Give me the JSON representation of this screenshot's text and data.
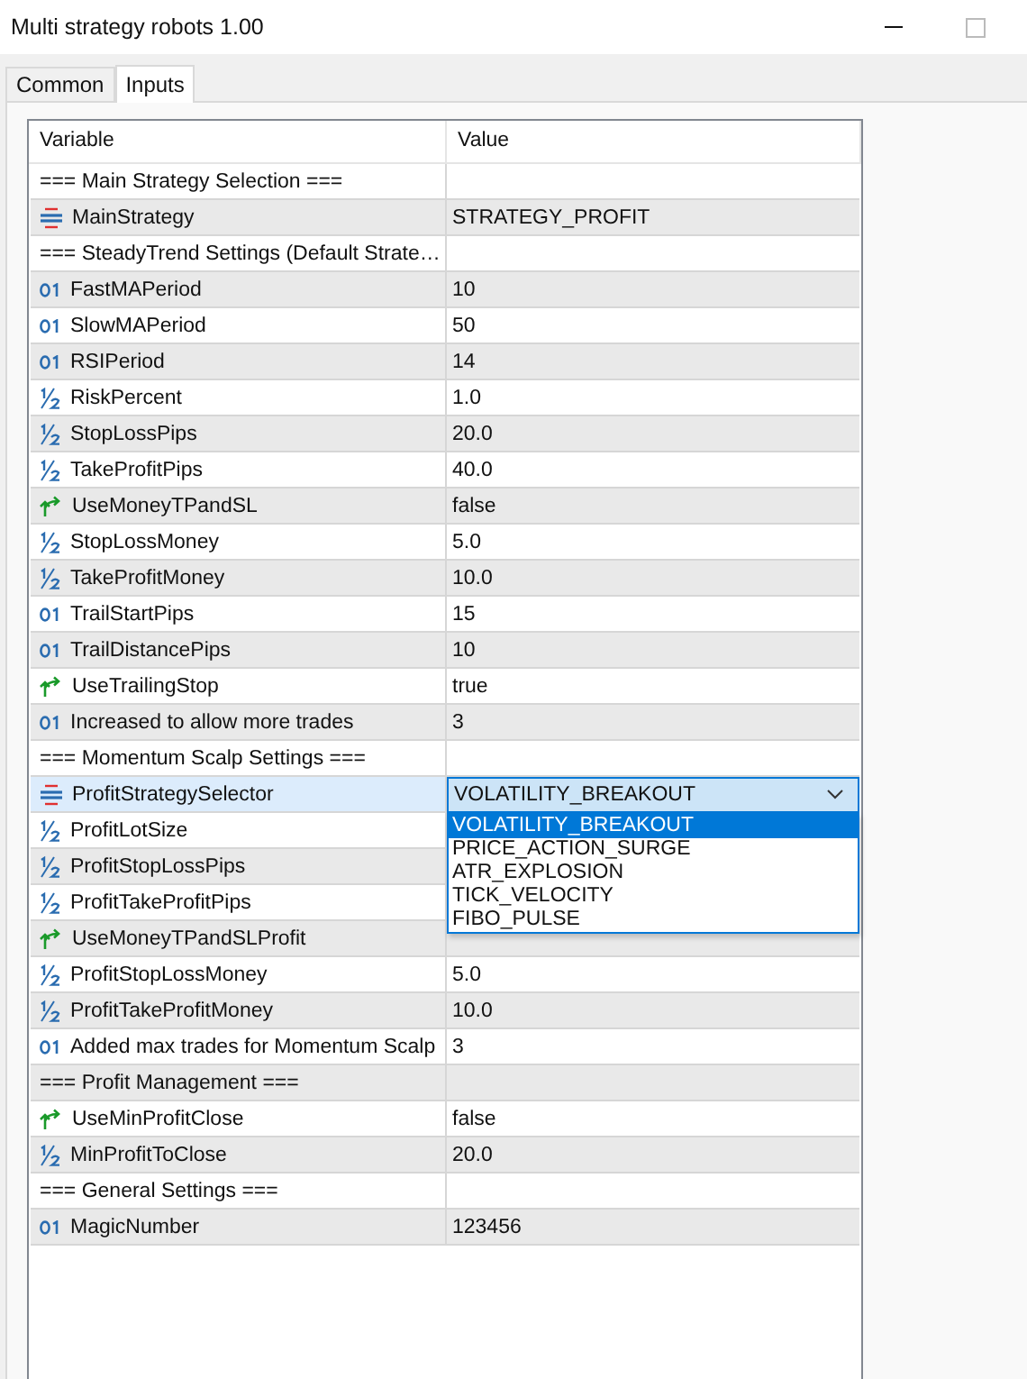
{
  "window": {
    "title": "Multi strategy robots 1.00"
  },
  "tabs": [
    {
      "label": "Common",
      "selected": false
    },
    {
      "label": "Inputs",
      "selected": true
    }
  ],
  "table": {
    "columns": [
      "Variable",
      "Value"
    ],
    "rows": [
      {
        "kind": "section",
        "name": "=== Main Strategy Selection ===",
        "selected": false
      },
      {
        "kind": "enum",
        "name": "MainStrategy",
        "value": "STRATEGY_PROFIT",
        "selected": false
      },
      {
        "kind": "section",
        "name": "=== SteadyTrend Settings (Default Strate…",
        "selected": false
      },
      {
        "kind": "int",
        "name": "FastMAPeriod",
        "value": "10",
        "selected": false
      },
      {
        "kind": "int",
        "name": "SlowMAPeriod",
        "value": "50",
        "selected": false
      },
      {
        "kind": "int",
        "name": "RSIPeriod",
        "value": "14",
        "selected": false
      },
      {
        "kind": "double",
        "name": "RiskPercent",
        "value": "1.0",
        "selected": false
      },
      {
        "kind": "double",
        "name": "StopLossPips",
        "value": "20.0",
        "selected": false
      },
      {
        "kind": "double",
        "name": "TakeProfitPips",
        "value": "40.0",
        "selected": false
      },
      {
        "kind": "bool",
        "name": "UseMoneyTPandSL",
        "value": "false",
        "selected": false
      },
      {
        "kind": "double",
        "name": "StopLossMoney",
        "value": "5.0",
        "selected": false
      },
      {
        "kind": "double",
        "name": "TakeProfitMoney",
        "value": "10.0",
        "selected": false
      },
      {
        "kind": "int",
        "name": "TrailStartPips",
        "value": "15",
        "selected": false
      },
      {
        "kind": "int",
        "name": "TrailDistancePips",
        "value": "10",
        "selected": false
      },
      {
        "kind": "bool",
        "name": "UseTrailingStop",
        "value": "true",
        "selected": false
      },
      {
        "kind": "int",
        "name": "Increased to allow more trades",
        "value": "3",
        "selected": false
      },
      {
        "kind": "section",
        "name": "=== Momentum Scalp Settings ===",
        "selected": false
      },
      {
        "kind": "enum",
        "name": "ProfitStrategySelector",
        "selected": true,
        "dropdown": {
          "value": "VOLATILITY_BREAKOUT",
          "options": [
            {
              "label": "VOLATILITY_BREAKOUT",
              "selected": true
            },
            {
              "label": "PRICE_ACTION_SURGE",
              "selected": false
            },
            {
              "label": "ATR_EXPLOSION",
              "selected": false
            },
            {
              "label": "TICK_VELOCITY",
              "selected": false
            },
            {
              "label": "FIBO_PULSE",
              "selected": false
            }
          ]
        }
      },
      {
        "kind": "double",
        "name": "ProfitLotSize",
        "selected": false
      },
      {
        "kind": "double",
        "name": "ProfitStopLossPips",
        "selected": false
      },
      {
        "kind": "double",
        "name": "ProfitTakeProfitPips",
        "selected": false
      },
      {
        "kind": "bool",
        "name": "UseMoneyTPandSLProfit",
        "selected": false
      },
      {
        "kind": "double",
        "name": "ProfitStopLossMoney",
        "value": "5.0",
        "selected": false
      },
      {
        "kind": "double",
        "name": "ProfitTakeProfitMoney",
        "value": "10.0",
        "selected": false
      },
      {
        "kind": "int",
        "name": "Added max trades for Momentum Scalp",
        "value": "3",
        "selected": false
      },
      {
        "kind": "section",
        "name": "=== Profit Management ===",
        "selected": false
      },
      {
        "kind": "bool",
        "name": "UseMinProfitClose",
        "value": "false",
        "selected": false
      },
      {
        "kind": "double",
        "name": "MinProfitToClose",
        "value": "20.0",
        "selected": false
      },
      {
        "kind": "section",
        "name": "=== General Settings ===",
        "selected": false
      },
      {
        "kind": "int",
        "name": "MagicNumber",
        "value": "123456",
        "selected": false
      }
    ]
  }
}
